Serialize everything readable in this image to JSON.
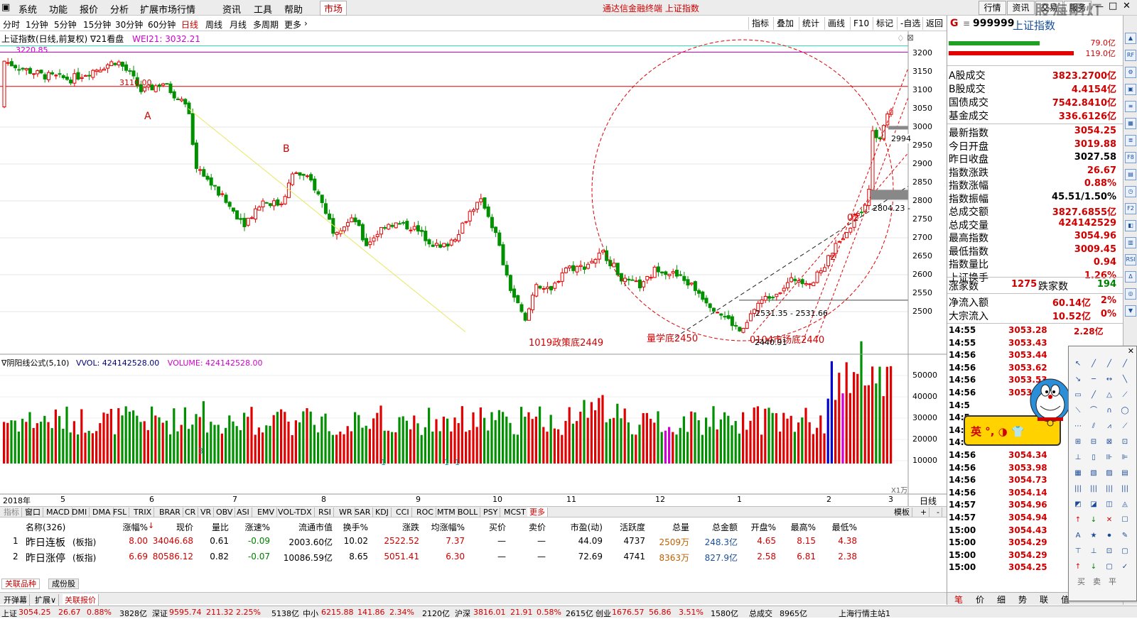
{
  "menubar": {
    "items": [
      "系统",
      "功能",
      "报价",
      "分析",
      "扩展市场行情",
      "资讯",
      "工具",
      "帮助"
    ],
    "active_tab": "市场",
    "title": "通达信金融终端  上证指数",
    "right_buttons": [
      "行情",
      "资讯",
      "交易",
      "服务"
    ],
    "watermark": "股海明灯"
  },
  "periods": {
    "items": [
      "分时",
      "1分钟",
      "5分钟",
      "15分钟",
      "30分钟",
      "60分钟",
      "日线",
      "周线",
      "月线",
      "多周期",
      "更多"
    ],
    "selected": "日线",
    "tools": [
      "指标",
      "叠加",
      "统计",
      "画线",
      "F10",
      "标记",
      "-自选",
      "返回"
    ]
  },
  "chart": {
    "title": "上证指数(日线,前复权) ∇21看盘",
    "wei_label": "WEI21: 3032.21",
    "price_axis": [
      "3200",
      "3150",
      "3100",
      "3050",
      "3000",
      "2950",
      "2900",
      "2850",
      "2800",
      "2750",
      "2700",
      "2650",
      "2600",
      "2550",
      "2500"
    ],
    "vol_axis": [
      "50000",
      "40000",
      "30000",
      "20000",
      "10000"
    ],
    "vol_unit": "X1万",
    "date_axis": [
      "2018年",
      "5",
      "6",
      "7",
      "8",
      "9",
      "10",
      "11",
      "12",
      "1",
      "2",
      "3"
    ],
    "date_axis_right": "日线",
    "annotations": {
      "top_price": "3220.85",
      "line_3110": "3110.00",
      "A": "A",
      "B": "B",
      "policy_bottom": "1019政策底2449",
      "quant_bottom": "量学底2450",
      "market_bottom": "0104市场底2440",
      "low_mark": "2440.91",
      "range_mark": "2531.35 - 2531.66",
      "mid_mark": "2804.23 -",
      "label_2994": "2994",
      "label_2": "2",
      "label_02": "02"
    },
    "vol_marks": [
      "3",
      "1",
      "1",
      "1",
      "1"
    ]
  },
  "volume": {
    "title": "∇阴阳线公式(5,10)",
    "vol": "VVOL: 424142528.00",
    "volume": "VOLUME: 424142528.00"
  },
  "indicator_tabs": [
    "指标",
    "窗口",
    "MACD",
    "DMI",
    "DMA",
    "FSL",
    "TRIX",
    "BRAR",
    "CR",
    "VR",
    "OBV",
    "ASI",
    "EMV",
    "VOL-TDX",
    "RSI",
    "WR",
    "SAR",
    "KDJ",
    "CCI",
    "ROC",
    "MTM",
    "BOLL",
    "PSY",
    "MCST",
    "更多"
  ],
  "indicator_tabs_right": [
    "模板",
    "+",
    "-"
  ],
  "table": {
    "headers": [
      "名称(326)",
      "涨幅%",
      "现价",
      "量比",
      "涨速%",
      "流通市值",
      "换手%",
      "涨跌",
      "均涨幅%",
      "买价",
      "卖价",
      "市盈(动)",
      "活跃度",
      "总量",
      "总金额",
      "开盘%",
      "最高%",
      "最低%"
    ],
    "rows": [
      {
        "no": "1",
        "name": "昨日连板",
        "tag": "(板指)",
        "chg": "8.00",
        "price": "34046.68",
        "lb": "0.61",
        "speed": "-0.09",
        "mcap": "2003.60亿",
        "turn": "10.02",
        "diff": "2522.52",
        "avg": "7.37",
        "bid": "—",
        "ask": "—",
        "pe": "44.09",
        "act": "4737",
        "vol": "2509万",
        "amt": "248.3亿",
        "open": "4.65",
        "high": "8.15",
        "low": "4.38"
      },
      {
        "no": "2",
        "name": "昨日涨停",
        "tag": "(板指)",
        "chg": "6.69",
        "price": "80586.12",
        "lb": "0.82",
        "speed": "-0.07",
        "mcap": "10086.59亿",
        "turn": "8.65",
        "diff": "5051.41",
        "avg": "6.30",
        "bid": "—",
        "ask": "—",
        "pe": "72.69",
        "act": "4741",
        "vol": "8363万",
        "amt": "827.9亿",
        "open": "2.58",
        "high": "6.81",
        "low": "2.38"
      }
    ]
  },
  "bottom_tabs": [
    "关联品种",
    "成份股"
  ],
  "bottom_tabs2": [
    "开弹幕",
    "扩展∨",
    "关联报价"
  ],
  "status": [
    {
      "t": "上证",
      "c": "#000"
    },
    {
      "t": "3054.25",
      "c": "#d00000"
    },
    {
      "t": "26.67",
      "c": "#d00000"
    },
    {
      "t": "0.88%",
      "c": "#d00000"
    },
    {
      "t": "3828亿",
      "c": "#000"
    },
    {
      "t": "深证",
      "c": "#000"
    },
    {
      "t": "9595.74",
      "c": "#d00000"
    },
    {
      "t": "211.32",
      "c": "#d00000"
    },
    {
      "t": "2.25%",
      "c": "#d00000"
    },
    {
      "t": "5138亿",
      "c": "#000"
    },
    {
      "t": "中小",
      "c": "#000"
    },
    {
      "t": "6215.88",
      "c": "#d00000"
    },
    {
      "t": "141.86",
      "c": "#d00000"
    },
    {
      "t": "2.34%",
      "c": "#d00000"
    },
    {
      "t": "2120亿",
      "c": "#000"
    },
    {
      "t": "沪深",
      "c": "#000"
    },
    {
      "t": "3816.01",
      "c": "#d00000"
    },
    {
      "t": "21.91",
      "c": "#d00000"
    },
    {
      "t": "0.58%",
      "c": "#d00000"
    },
    {
      "t": "2615亿",
      "c": "#000"
    },
    {
      "t": "创业",
      "c": "#000"
    },
    {
      "t": "1676.57",
      "c": "#d00000"
    },
    {
      "t": "56.86",
      "c": "#d00000"
    },
    {
      "t": "3.51%",
      "c": "#d00000"
    },
    {
      "t": "1580亿",
      "c": "#000"
    },
    {
      "t": "总成交",
      "c": "#000"
    },
    {
      "t": "8965亿",
      "c": "#000"
    },
    {
      "t": "上海行情主站1",
      "c": "#000"
    }
  ],
  "quote": {
    "code": "999999",
    "name": "上证指数",
    "header_mark": "G",
    "top_vals": [
      "79.0亿",
      "119.0亿"
    ],
    "rows": [
      {
        "l": "A股成交",
        "v": "3823.2700亿",
        "c": "#d00000"
      },
      {
        "l": "B股成交",
        "v": "4.4154亿",
        "c": "#d00000"
      },
      {
        "l": "国债成交",
        "v": "7542.8410亿",
        "c": "#d00000"
      },
      {
        "l": "基金成交",
        "v": "336.6126亿",
        "c": "#d00000"
      },
      {
        "l": "最新指数",
        "v": "3054.25",
        "c": "#d00000"
      },
      {
        "l": "今日开盘",
        "v": "3019.88",
        "c": "#d00000"
      },
      {
        "l": "昨日收盘",
        "v": "3027.58",
        "c": "#000"
      },
      {
        "l": "指数涨跌",
        "v": "26.67",
        "c": "#d00000"
      },
      {
        "l": "指数涨幅",
        "v": "0.88%",
        "c": "#d00000"
      },
      {
        "l": "指数振幅",
        "v": "45.51/1.50%",
        "c": "#000"
      },
      {
        "l": "总成交额",
        "v": "3827.6855亿",
        "c": "#d00000"
      },
      {
        "l": "总成交量",
        "v": "424142529",
        "c": "#d00000"
      },
      {
        "l": "最高指数",
        "v": "3054.96",
        "c": "#d00000"
      },
      {
        "l": "最低指数",
        "v": "3009.45",
        "c": "#d00000"
      },
      {
        "l": "指数量比",
        "v": "0.94",
        "c": "#d00000"
      },
      {
        "l": "上证换手",
        "v": "1.26%",
        "c": "#d00000"
      }
    ],
    "updown": {
      "up_l": "涨家数",
      "up_v": "1275",
      "down_l": "跌家数",
      "down_v": "194"
    },
    "flows": [
      {
        "l": "净流入额",
        "v": "60.14亿",
        "p": "2%"
      },
      {
        "l": "大宗流入",
        "v": "10.52亿",
        "p": "0%"
      }
    ],
    "ticks": [
      {
        "t": "14:55",
        "p": "3053.28",
        "v": "2.28亿"
      },
      {
        "t": "14:55",
        "p": "3053.43",
        "v": ""
      },
      {
        "t": "14:56",
        "p": "3053.44",
        "v": ""
      },
      {
        "t": "14:56",
        "p": "3053.62",
        "v": ""
      },
      {
        "t": "14:56",
        "p": "3053.53",
        "v": ""
      },
      {
        "t": "14:56",
        "p": "3053.2",
        "v": ""
      },
      {
        "t": "14:5",
        "p": "",
        "v": ""
      },
      {
        "t": "14:5",
        "p": "",
        "v": ""
      },
      {
        "t": "14:5",
        "p": "",
        "v": ""
      },
      {
        "t": "14:56",
        "p": "3053.99",
        "v": ""
      },
      {
        "t": "14:56",
        "p": "3054.34",
        "v": ""
      },
      {
        "t": "14:56",
        "p": "3053.98",
        "v": ""
      },
      {
        "t": "14:56",
        "p": "3054.73",
        "v": ""
      },
      {
        "t": "14:56",
        "p": "3054.14",
        "v": ""
      },
      {
        "t": "14:57",
        "p": "3054.96",
        "v": ""
      },
      {
        "t": "14:57",
        "p": "3054.94",
        "v": ""
      },
      {
        "t": "15:00",
        "p": "3054.43",
        "v": ""
      },
      {
        "t": "15:00",
        "p": "3054.29",
        "v": ""
      },
      {
        "t": "15:00",
        "p": "3054.29",
        "v": ""
      },
      {
        "t": "15:00",
        "p": "3054.25",
        "v": ""
      }
    ],
    "bottom_tabs": [
      "笔",
      "价",
      "细",
      "势",
      "联",
      "值"
    ]
  },
  "popup": {
    "text": "英 °, ◑ 👕"
  },
  "drawtool": {
    "bottom_labels": [
      "买",
      "卖",
      "平"
    ]
  },
  "colors": {
    "up": "#e00000",
    "down": "#009000",
    "accent": "#d00000",
    "blue": "#1a4f9c"
  }
}
